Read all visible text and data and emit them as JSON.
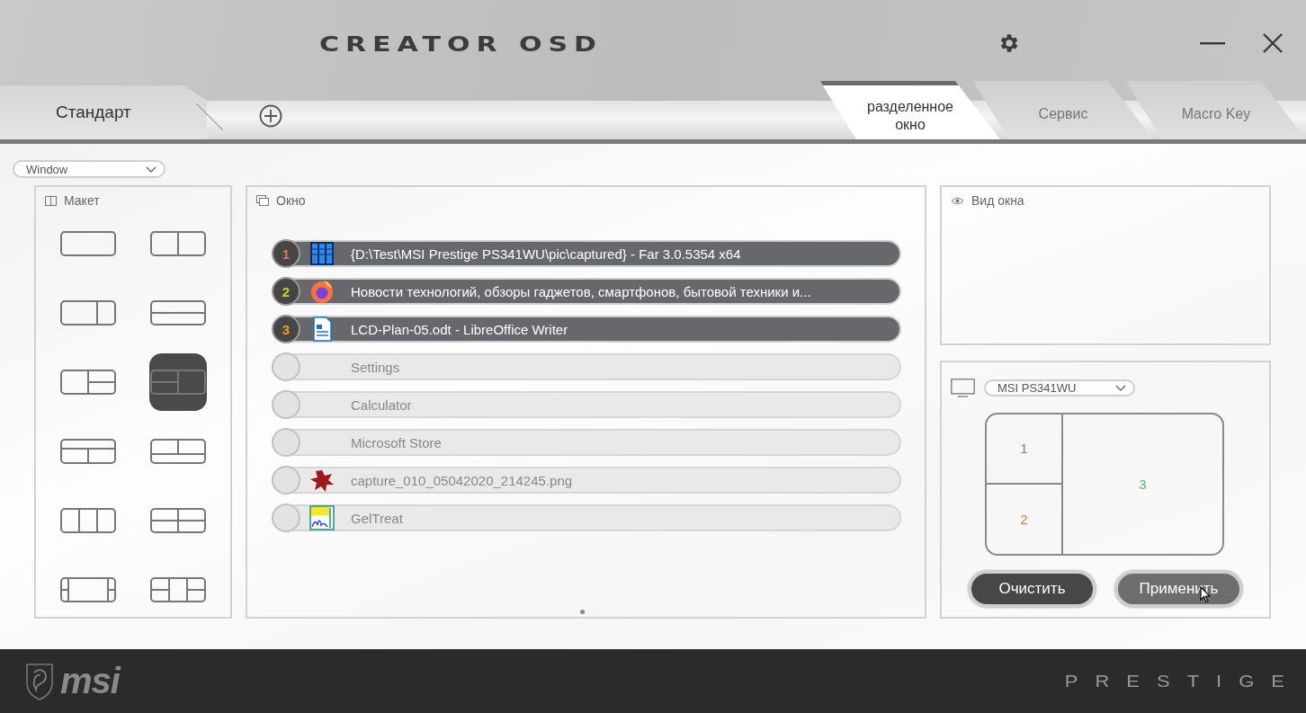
{
  "window": {
    "title": "CREATOR OSD"
  },
  "profile_tabs": [
    {
      "label": "Стандарт",
      "selected": true
    }
  ],
  "mode_tabs": [
    {
      "label": "разделенное окно",
      "selected": true
    },
    {
      "label": "Сервис",
      "selected": false
    },
    {
      "label": "Macro Key",
      "selected": false
    }
  ],
  "source_dropdown": {
    "value": "Window"
  },
  "layout_panel": {
    "title": "Макет",
    "options": [
      {
        "kind": "full",
        "selected": false
      },
      {
        "kind": "cols-2",
        "selected": false
      },
      {
        "kind": "cols-wide-left",
        "selected": false
      },
      {
        "kind": "rows-2",
        "selected": false
      },
      {
        "kind": "left-right-split",
        "selected": false
      },
      {
        "kind": "left-split-right",
        "selected": true
      },
      {
        "kind": "top-bottom-split",
        "selected": false
      },
      {
        "kind": "top-split-bottom",
        "selected": false
      },
      {
        "kind": "cols-3",
        "selected": false
      },
      {
        "kind": "grid-4",
        "selected": false
      },
      {
        "kind": "sides-split",
        "selected": false
      },
      {
        "kind": "cols-3-sides-split",
        "selected": false
      }
    ]
  },
  "window_panel": {
    "title": "Окно",
    "windows": [
      {
        "number": "1",
        "color": "#e0735c",
        "kind": "file-manager",
        "title": "{D:\\Test\\MSI Prestige PS341WU\\pic\\captured} - Far 3.0.5354 x64",
        "assigned": true
      },
      {
        "number": "2",
        "color": "#c8d22a",
        "kind": "browser",
        "title": "Новости технологий, обзоры гаджетов, смартфонов, бытовой техники и...",
        "assigned": true
      },
      {
        "number": "3",
        "color": "#f0a020",
        "kind": "document",
        "title": "LCD-Plan-05.odt - LibreOffice Writer",
        "assigned": true
      },
      {
        "kind": "none",
        "title": "Settings",
        "assigned": false
      },
      {
        "kind": "none",
        "title": "Calculator",
        "assigned": false
      },
      {
        "kind": "none",
        "title": "Microsoft Store",
        "assigned": false
      },
      {
        "kind": "image-editor",
        "title": "capture_010_05042020_214245.png",
        "assigned": false
      },
      {
        "kind": "chart-app",
        "title": "GelTreat",
        "assigned": false
      }
    ]
  },
  "preview_panel": {
    "title": "Вид окна"
  },
  "monitor_panel": {
    "monitor": "MSI PS341WU",
    "zones": [
      {
        "label": "1",
        "color": "#5b86d6"
      },
      {
        "label": "2",
        "color": "#ee7046"
      },
      {
        "label": "3",
        "color": "#5fb85f"
      }
    ],
    "buttons": [
      {
        "label": "Очистить",
        "hovered": false
      },
      {
        "label": "Применить",
        "hovered": true
      }
    ]
  },
  "footer": {
    "brand": "msi",
    "series": "PRESTIGE"
  }
}
